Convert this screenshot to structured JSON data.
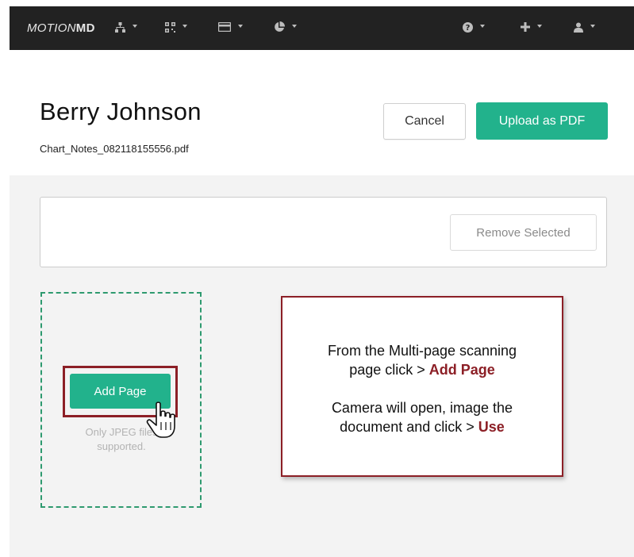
{
  "navbar": {
    "brand_light": "MOTION",
    "brand_bold": "MD",
    "icons": [
      "org-chart-icon",
      "qr-code-icon",
      "credit-card-icon",
      "pie-chart-icon",
      "help-icon",
      "plus-icon",
      "user-icon"
    ]
  },
  "header": {
    "patient_name": "Berry Johnson",
    "file_name": "Chart_Notes_082118155556.pdf",
    "cancel_label": "Cancel",
    "upload_label": "Upload as PDF"
  },
  "toolbar": {
    "remove_label": "Remove Selected"
  },
  "upload_area": {
    "add_page_label": "Add Page",
    "support_text": "Only JPEG files supported."
  },
  "callout": {
    "line1": "From the Multi-page scanning",
    "line2_prefix": "page click > ",
    "line2_highlight": "Add Page",
    "line3": "Camera will open, image the",
    "line4_prefix": "document and click > ",
    "line4_highlight": "Use"
  },
  "colors": {
    "navbar": "#222222",
    "accent": "#22b28c",
    "highlight": "#8c1f26",
    "dashed_border": "#2e9a6f"
  }
}
